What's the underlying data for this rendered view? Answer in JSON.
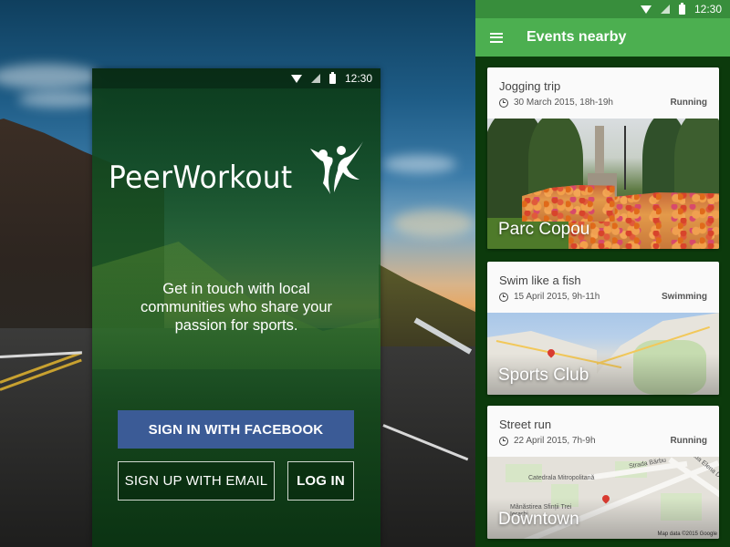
{
  "login_screen": {
    "status_bar": {
      "time": "12:30",
      "icons": [
        "wifi-icon",
        "signal-icon",
        "battery-icon"
      ]
    },
    "app_name": "PeerWorkout",
    "logo_icon": "two-people-jumping-icon",
    "tagline": "Get in touch with local communities who share your passion for sports.",
    "buttons": {
      "facebook": "SIGN IN WITH FACEBOOK",
      "email": "SIGN UP WITH EMAIL",
      "login": "LOG IN"
    },
    "colors": {
      "facebook": "#3b5b96",
      "overlay": "#1b5e20"
    }
  },
  "events_screen": {
    "status_bar": {
      "time": "12:30",
      "icons": [
        "wifi-icon",
        "signal-icon",
        "battery-icon"
      ]
    },
    "app_bar": {
      "title": "Events nearby",
      "menu_icon": "hamburger-menu-icon"
    },
    "colors": {
      "app_bar": "#4caf50",
      "status_bar": "#388e3c",
      "background": "#0c3a0c"
    },
    "events": [
      {
        "title": "Jogging trip",
        "datetime": "30 March 2015, 18h-19h",
        "category": "Running",
        "place": "Parc Copou",
        "image": "park-photo"
      },
      {
        "title": "Swim like a fish",
        "datetime": "15 April 2015, 9h-11h",
        "category": "Swimming",
        "place": "Sports Club",
        "image": "coastal-map"
      },
      {
        "title": "Street run",
        "datetime": "22 April 2015, 7h-9h",
        "category": "Running",
        "place": "Downtown",
        "image": "city-map"
      }
    ],
    "map_labels": {
      "cathedral": "Catedrala Mitropolitană",
      "monastery": "Mânăstirea Sfinții Trei Ierarhi",
      "street_barbu": "Strada Bărbu",
      "street_elena": "Strada Elena Doamna",
      "credit": "Map data ©2015 Google"
    }
  }
}
